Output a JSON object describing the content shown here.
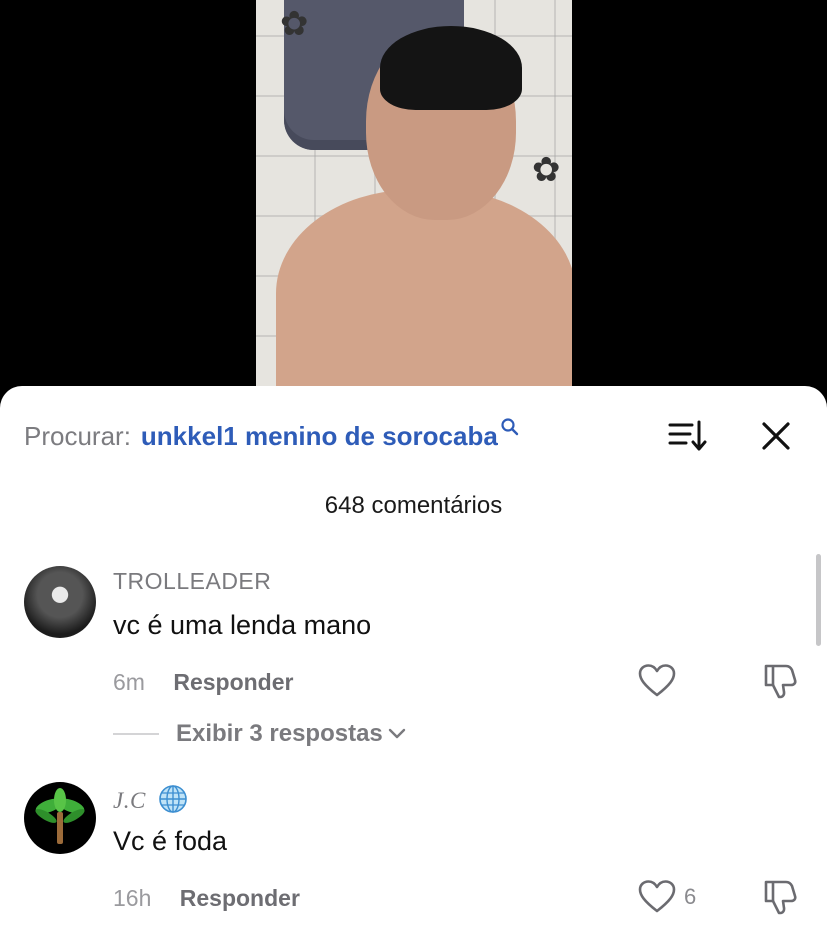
{
  "search": {
    "prefix": "Procurar:",
    "query": "unkkel1 menino de sorocaba"
  },
  "comments_count_label": "648 comentários",
  "comments": [
    {
      "username": "TROLLEADER",
      "text": "vc é uma lenda mano",
      "time": "6m",
      "reply_label": "Responder",
      "likes": "",
      "replies_label": "Exibir 3 respostas"
    },
    {
      "username": "J.C",
      "username_badge": "globe-emoji",
      "text": "Vc é foda",
      "time": "16h",
      "reply_label": "Responder",
      "likes": "6"
    }
  ],
  "icons": {
    "search": "search-icon",
    "sort": "sort-icon",
    "close": "close-icon",
    "like": "heart-icon",
    "dislike": "thumbs-down-icon",
    "chevron": "chevron-down-icon"
  },
  "colors": {
    "query_link": "#2e5cb8",
    "sheet_bg": "#ffffff",
    "secondary_text": "#7a7a7e"
  }
}
